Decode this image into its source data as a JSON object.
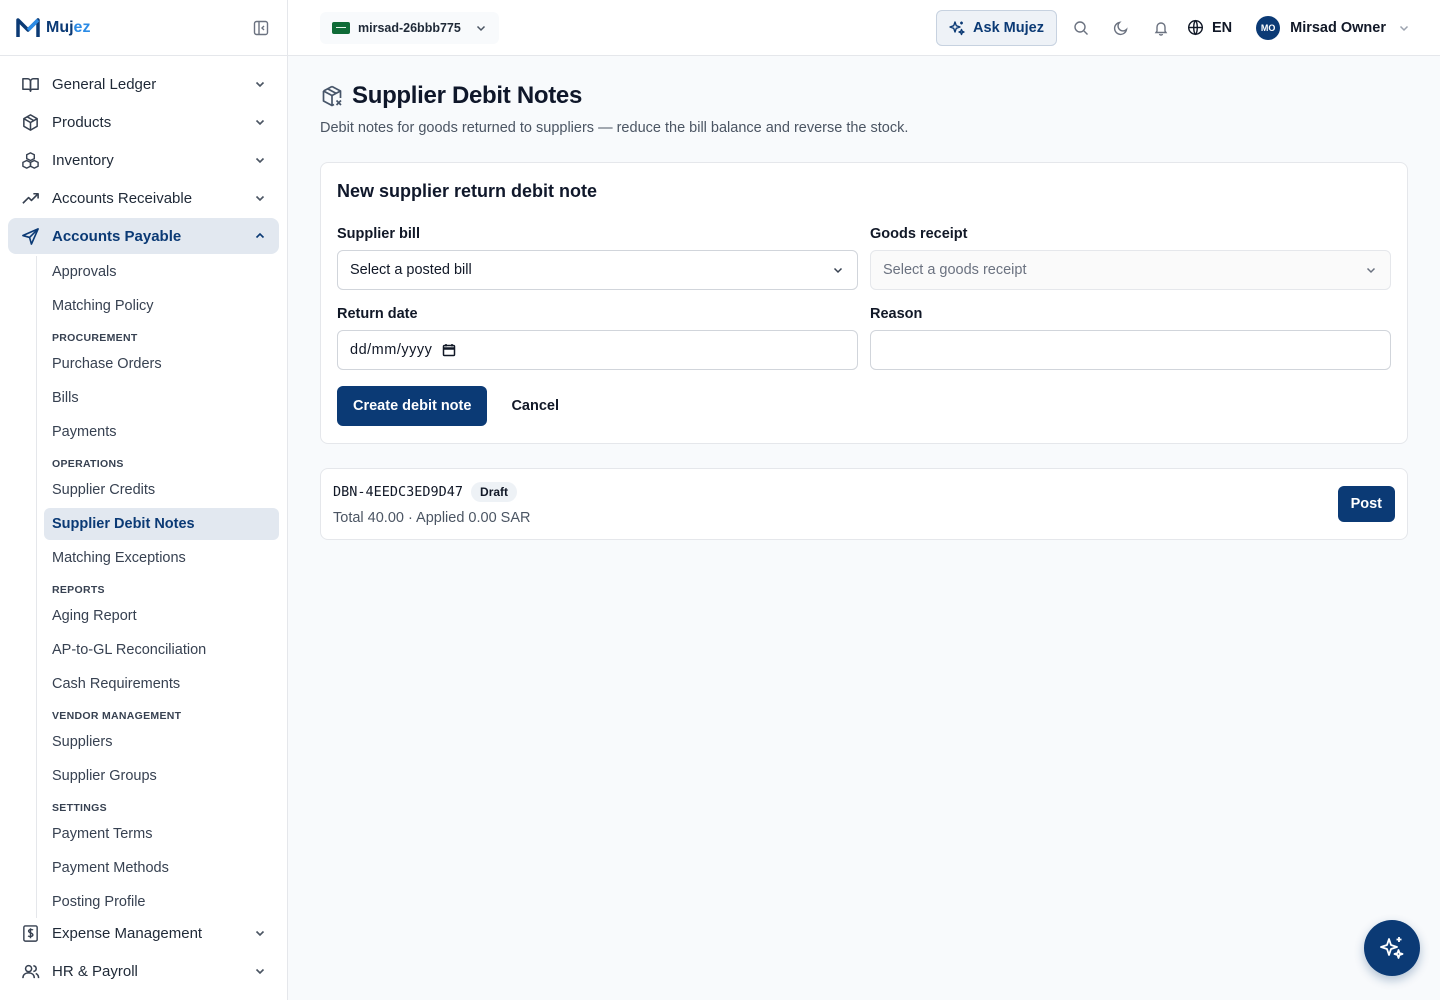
{
  "brand": {
    "name_main": "Muj",
    "name_accent": "ez"
  },
  "sidebar": {
    "groups_top": [
      {
        "label": "General Ledger",
        "icon": "book-open-icon"
      },
      {
        "label": "Products",
        "icon": "package-icon"
      },
      {
        "label": "Inventory",
        "icon": "boxes-icon"
      },
      {
        "label": "Accounts Receivable",
        "icon": "trending-up-icon"
      }
    ],
    "active_group": {
      "label": "Accounts Payable",
      "icon": "send-icon"
    },
    "sub": {
      "approvals": "Approvals",
      "matching_policy": "Matching Policy",
      "sec_procurement": "PROCUREMENT",
      "purchase_orders": "Purchase Orders",
      "bills": "Bills",
      "payments": "Payments",
      "sec_operations": "OPERATIONS",
      "supplier_credits": "Supplier Credits",
      "supplier_debit_notes": "Supplier Debit Notes",
      "matching_exceptions": "Matching Exceptions",
      "sec_reports": "REPORTS",
      "aging_report": "Aging Report",
      "ap_gl": "AP-to-GL Reconciliation",
      "cash_requirements": "Cash Requirements",
      "sec_vendor": "VENDOR MANAGEMENT",
      "suppliers": "Suppliers",
      "supplier_groups": "Supplier Groups",
      "sec_settings": "SETTINGS",
      "payment_terms": "Payment Terms",
      "payment_methods": "Payment Methods",
      "posting_profile": "Posting Profile"
    },
    "groups_bottom": [
      {
        "label": "Expense Management",
        "icon": "receipt-icon"
      },
      {
        "label": "HR & Payroll",
        "icon": "users-icon"
      }
    ]
  },
  "topbar": {
    "org": "mirsad-26bbb775",
    "ask": "Ask Mujez",
    "lang": "EN",
    "user_initials": "MO",
    "user_name": "Mirsad Owner"
  },
  "page": {
    "title": "Supplier Debit Notes",
    "subtitle": "Debit notes for goods returned to suppliers — reduce the bill balance and reverse the stock."
  },
  "form": {
    "title": "New supplier return debit note",
    "supplier_bill_label": "Supplier bill",
    "supplier_bill_value": "Select a posted bill",
    "goods_receipt_label": "Goods receipt",
    "goods_receipt_value": "Select a goods receipt",
    "return_date_label": "Return date",
    "return_date_value": "dd/mm/yyyy",
    "reason_label": "Reason",
    "reason_value": "",
    "create_label": "Create debit note",
    "cancel_label": "Cancel"
  },
  "notes": [
    {
      "id": "DBN-4EEDC3ED9D47",
      "status": "Draft",
      "meta": "Total 40.00 · Applied 0.00 SAR",
      "action": "Post"
    }
  ],
  "colors": {
    "primary": "#0b3a75",
    "accent": "#2b8be6"
  }
}
